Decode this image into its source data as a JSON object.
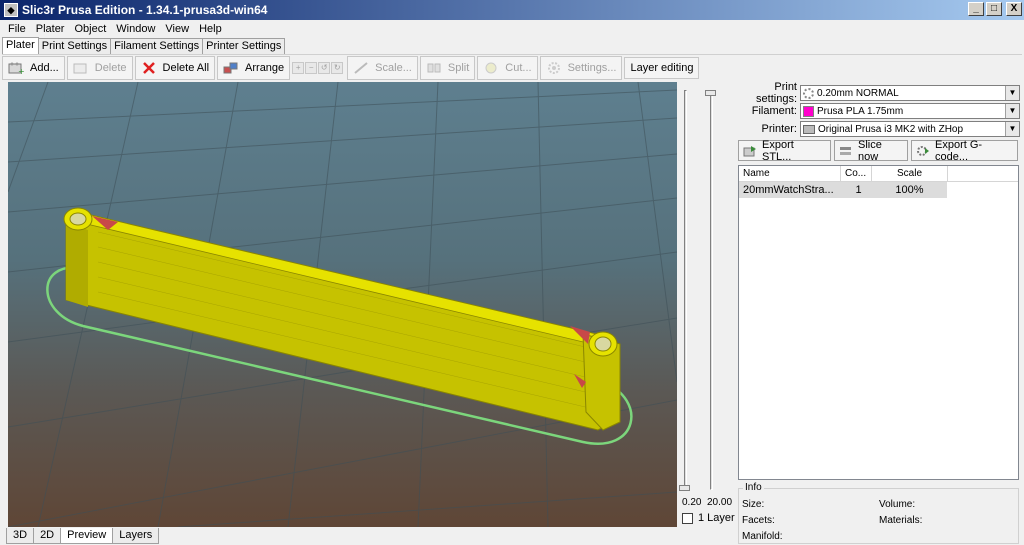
{
  "window": {
    "title": "Slic3r Prusa Edition - 1.34.1-prusa3d-win64",
    "min_label": "_",
    "max_label": "□",
    "close_label": "X"
  },
  "menu": [
    "File",
    "Plater",
    "Object",
    "Window",
    "View",
    "Help"
  ],
  "tabs": [
    {
      "label": "Plater",
      "active": true
    },
    {
      "label": "Print Settings",
      "active": false
    },
    {
      "label": "Filament Settings",
      "active": false
    },
    {
      "label": "Printer Settings",
      "active": false
    }
  ],
  "toolbar": {
    "add": "Add...",
    "delete": "Delete",
    "delete_all": "Delete All",
    "arrange": "Arrange",
    "scale": "Scale...",
    "split": "Split",
    "cut": "Cut...",
    "settings": "Settings...",
    "layer_editing": "Layer editing"
  },
  "view_tabs": [
    {
      "label": "3D",
      "active": false
    },
    {
      "label": "2D",
      "active": false
    },
    {
      "label": "Preview",
      "active": true
    },
    {
      "label": "Layers",
      "active": false
    }
  ],
  "slider": {
    "min_value": "0.20",
    "max_value": "20.00",
    "layer_checkbox_label": "1 Layer"
  },
  "settings": {
    "print_label": "Print settings:",
    "print_value": "0.20mm NORMAL",
    "filament_label": "Filament:",
    "filament_value": "Prusa PLA 1.75mm",
    "filament_color": "#ff00cc",
    "printer_label": "Printer:",
    "printer_value": "Original Prusa i3 MK2 with ZHop"
  },
  "actions": {
    "export_stl": "Export STL...",
    "slice_now": "Slice now",
    "export_gcode": "Export G-code..."
  },
  "object_list": {
    "headers": [
      "Name",
      "Co...",
      "Scale"
    ],
    "rows": [
      {
        "name": "20mmWatchStra...",
        "copies": "1",
        "scale": "100%"
      }
    ]
  },
  "info": {
    "title": "Info",
    "size_label": "Size:",
    "volume_label": "Volume:",
    "facets_label": "Facets:",
    "materials_label": "Materials:",
    "manifold_label": "Manifold:"
  },
  "colors": {
    "model_yellow": "#d4d000",
    "skirt_green": "#7cd67c",
    "infill_red": "#c04040"
  }
}
